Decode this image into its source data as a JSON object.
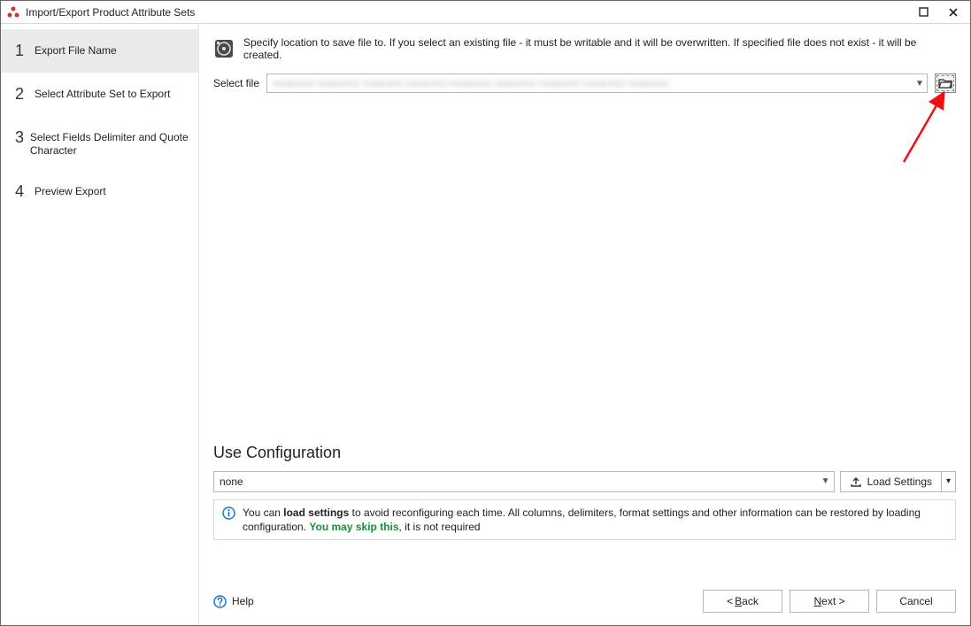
{
  "window": {
    "title": "Import/Export Product Attribute Sets",
    "icon": "app-icon"
  },
  "sidebar": {
    "steps": [
      {
        "num": "1",
        "label": "Export File Name",
        "active": true
      },
      {
        "num": "2",
        "label": "Select Attribute Set to Export",
        "active": false
      },
      {
        "num": "3",
        "label": "Select Fields Delimiter and Quote Character",
        "active": false
      },
      {
        "num": "4",
        "label": "Preview Export",
        "active": false
      }
    ]
  },
  "main": {
    "instruction": "Specify location to save file to. If you select an existing file - it must be writable and it will be overwritten. If specified file does not exist - it will be created.",
    "select_file_label": "Select file",
    "select_file_value": "",
    "browse_icon": "folder-open-icon"
  },
  "config": {
    "heading": "Use Configuration",
    "selected": "none",
    "load_label": "Load Settings",
    "info_pre": "You can ",
    "info_bold": "load settings",
    "info_mid": " to avoid reconfiguring each time. All columns, delimiters, format settings and other information can be restored by loading configuration. ",
    "info_green": "You may skip this",
    "info_post": ", it is not required"
  },
  "footer": {
    "help": "Help",
    "back": "Back",
    "next": "Next",
    "cancel": "Cancel"
  }
}
